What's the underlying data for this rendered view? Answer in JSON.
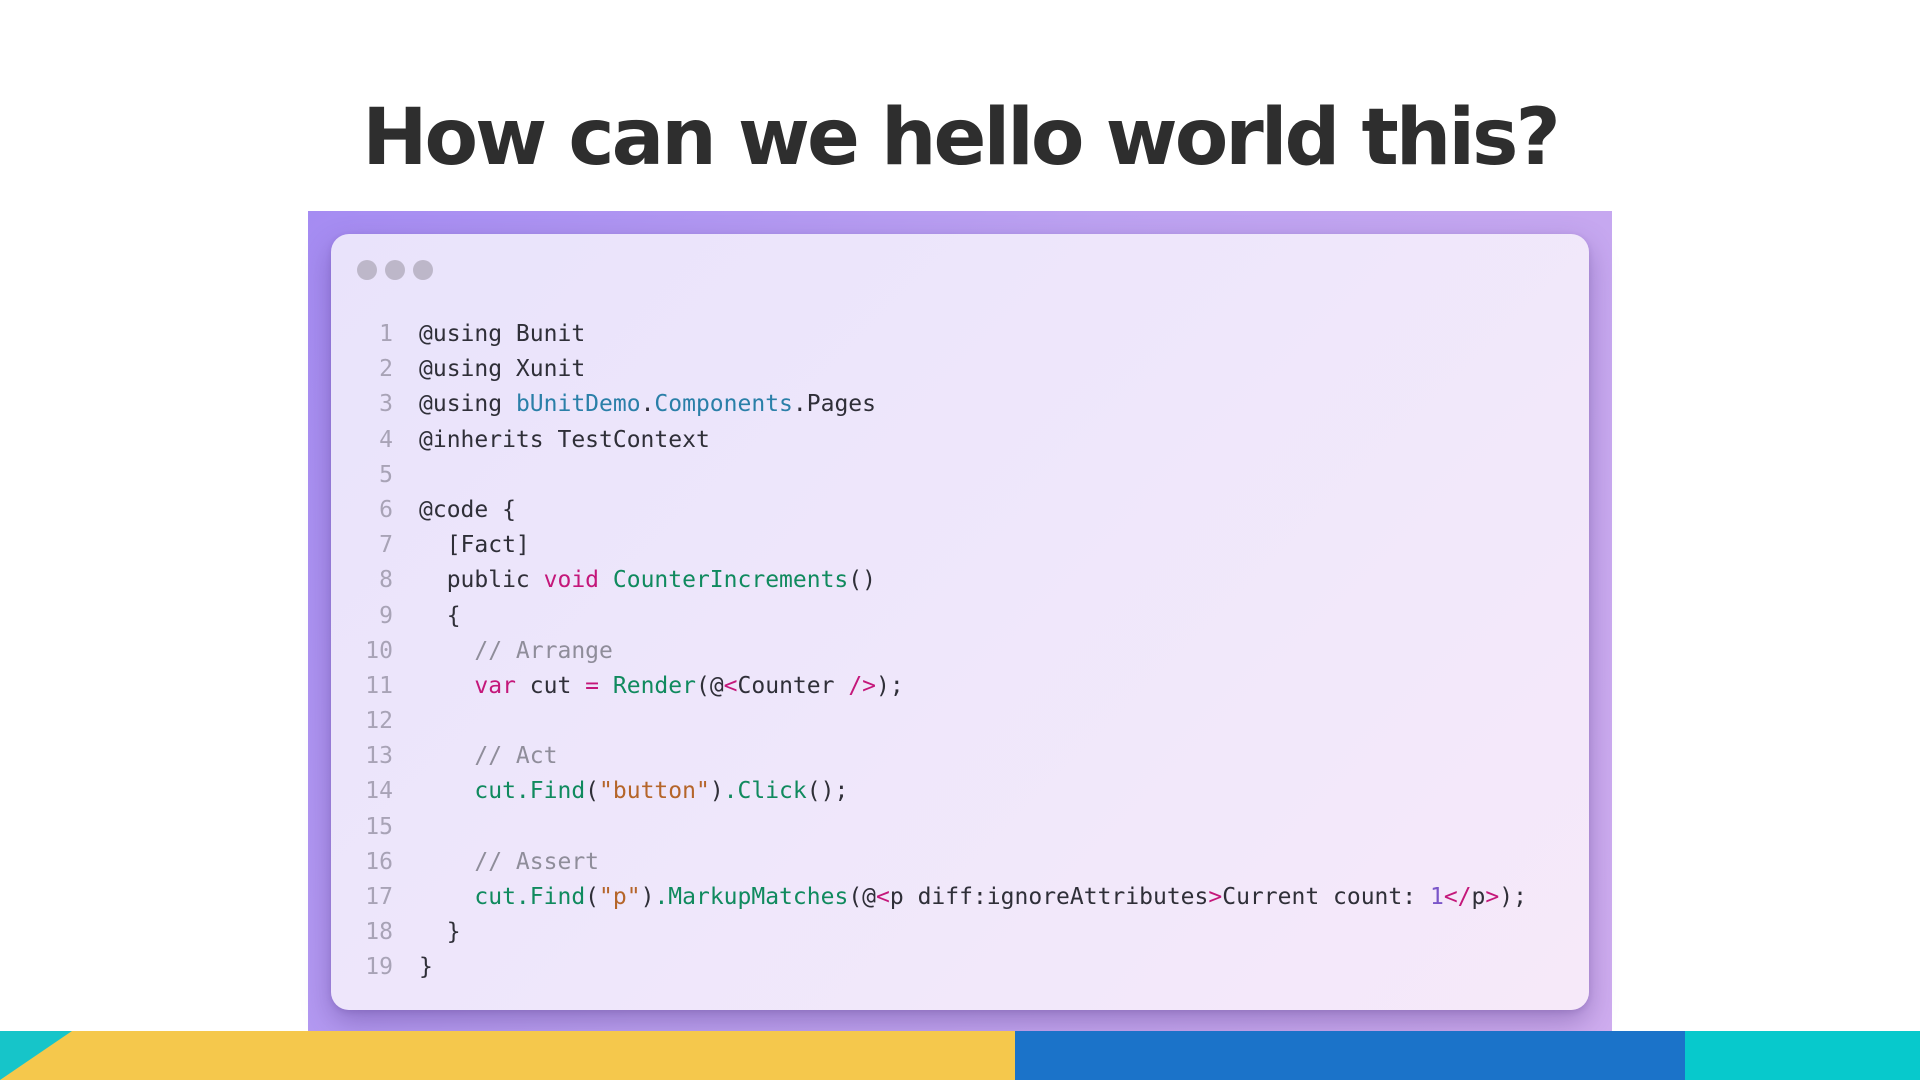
{
  "slide": {
    "title": "How can we hello world this?"
  },
  "colors": {
    "title": "#2e2e2e",
    "frame_gradient": [
      "#a58cf2",
      "#cfadef"
    ],
    "keyword": "#c4177a",
    "function": "#108a5e",
    "namespace": "#2a7fa8",
    "comment": "#8f8d9a",
    "string": "#b5652a",
    "number": "#7a55c9",
    "bar_yellow": "#f5c84c",
    "bar_blue": "#1b73c9",
    "bar_teal": "#07c9cc"
  },
  "editor": {
    "window_buttons": [
      "close-dot",
      "minimize-dot",
      "maximize-dot"
    ],
    "lines": [
      {
        "n": "1",
        "tokens": [
          {
            "t": "@using Bunit",
            "c": "plain"
          }
        ]
      },
      {
        "n": "2",
        "tokens": [
          {
            "t": "@using Xunit",
            "c": "plain"
          }
        ]
      },
      {
        "n": "3",
        "tokens": [
          {
            "t": "@using ",
            "c": "plain"
          },
          {
            "t": "bUnitDemo",
            "c": "ns"
          },
          {
            "t": ".",
            "c": "plain"
          },
          {
            "t": "Components",
            "c": "ns"
          },
          {
            "t": ".Pages",
            "c": "plain"
          }
        ]
      },
      {
        "n": "4",
        "tokens": [
          {
            "t": "@inherits TestContext",
            "c": "plain"
          }
        ]
      },
      {
        "n": "5",
        "tokens": []
      },
      {
        "n": "6",
        "tokens": [
          {
            "t": "@code {",
            "c": "plain"
          }
        ]
      },
      {
        "n": "7",
        "tokens": [
          {
            "t": "  [Fact]",
            "c": "plain"
          }
        ]
      },
      {
        "n": "8",
        "tokens": [
          {
            "t": "  public ",
            "c": "plain"
          },
          {
            "t": "void ",
            "c": "kw"
          },
          {
            "t": "CounterIncrements",
            "c": "fn"
          },
          {
            "t": "()",
            "c": "plain"
          }
        ]
      },
      {
        "n": "9",
        "tokens": [
          {
            "t": "  {",
            "c": "plain"
          }
        ]
      },
      {
        "n": "10",
        "tokens": [
          {
            "t": "    // Arrange",
            "c": "cm"
          }
        ]
      },
      {
        "n": "11",
        "tokens": [
          {
            "t": "    ",
            "c": "plain"
          },
          {
            "t": "var ",
            "c": "kw"
          },
          {
            "t": "cut ",
            "c": "plain"
          },
          {
            "t": "= ",
            "c": "kw"
          },
          {
            "t": "Render",
            "c": "fn"
          },
          {
            "t": "(@",
            "c": "plain"
          },
          {
            "t": "<",
            "c": "kw"
          },
          {
            "t": "Counter ",
            "c": "plain"
          },
          {
            "t": "/>",
            "c": "kw"
          },
          {
            "t": ");",
            "c": "plain"
          }
        ]
      },
      {
        "n": "12",
        "tokens": []
      },
      {
        "n": "13",
        "tokens": [
          {
            "t": "    // Act",
            "c": "cm"
          }
        ]
      },
      {
        "n": "14",
        "tokens": [
          {
            "t": "    ",
            "c": "plain"
          },
          {
            "t": "cut.Find",
            "c": "fn"
          },
          {
            "t": "(",
            "c": "plain"
          },
          {
            "t": "\"button\"",
            "c": "str"
          },
          {
            "t": ")",
            "c": "plain"
          },
          {
            "t": ".Click",
            "c": "fn"
          },
          {
            "t": "();",
            "c": "plain"
          }
        ]
      },
      {
        "n": "15",
        "tokens": []
      },
      {
        "n": "16",
        "tokens": [
          {
            "t": "    // Assert",
            "c": "cm"
          }
        ]
      },
      {
        "n": "17",
        "tokens": [
          {
            "t": "    ",
            "c": "plain"
          },
          {
            "t": "cut.Find",
            "c": "fn"
          },
          {
            "t": "(",
            "c": "plain"
          },
          {
            "t": "\"p\"",
            "c": "str"
          },
          {
            "t": ")",
            "c": "plain"
          },
          {
            "t": ".MarkupMatches",
            "c": "fn"
          },
          {
            "t": "(@",
            "c": "plain"
          },
          {
            "t": "<",
            "c": "kw"
          },
          {
            "t": "p diff:ignoreAttributes",
            "c": "plain"
          },
          {
            "t": ">",
            "c": "kw"
          },
          {
            "t": "Current count: ",
            "c": "plain"
          },
          {
            "t": "1",
            "c": "num"
          },
          {
            "t": "</",
            "c": "kw"
          },
          {
            "t": "p",
            "c": "plain"
          },
          {
            "t": ">",
            "c": "kw"
          },
          {
            "t": ");",
            "c": "plain"
          }
        ]
      },
      {
        "n": "18",
        "tokens": [
          {
            "t": "  }",
            "c": "plain"
          }
        ]
      },
      {
        "n": "19",
        "tokens": [
          {
            "t": "}",
            "c": "plain"
          }
        ]
      }
    ]
  }
}
